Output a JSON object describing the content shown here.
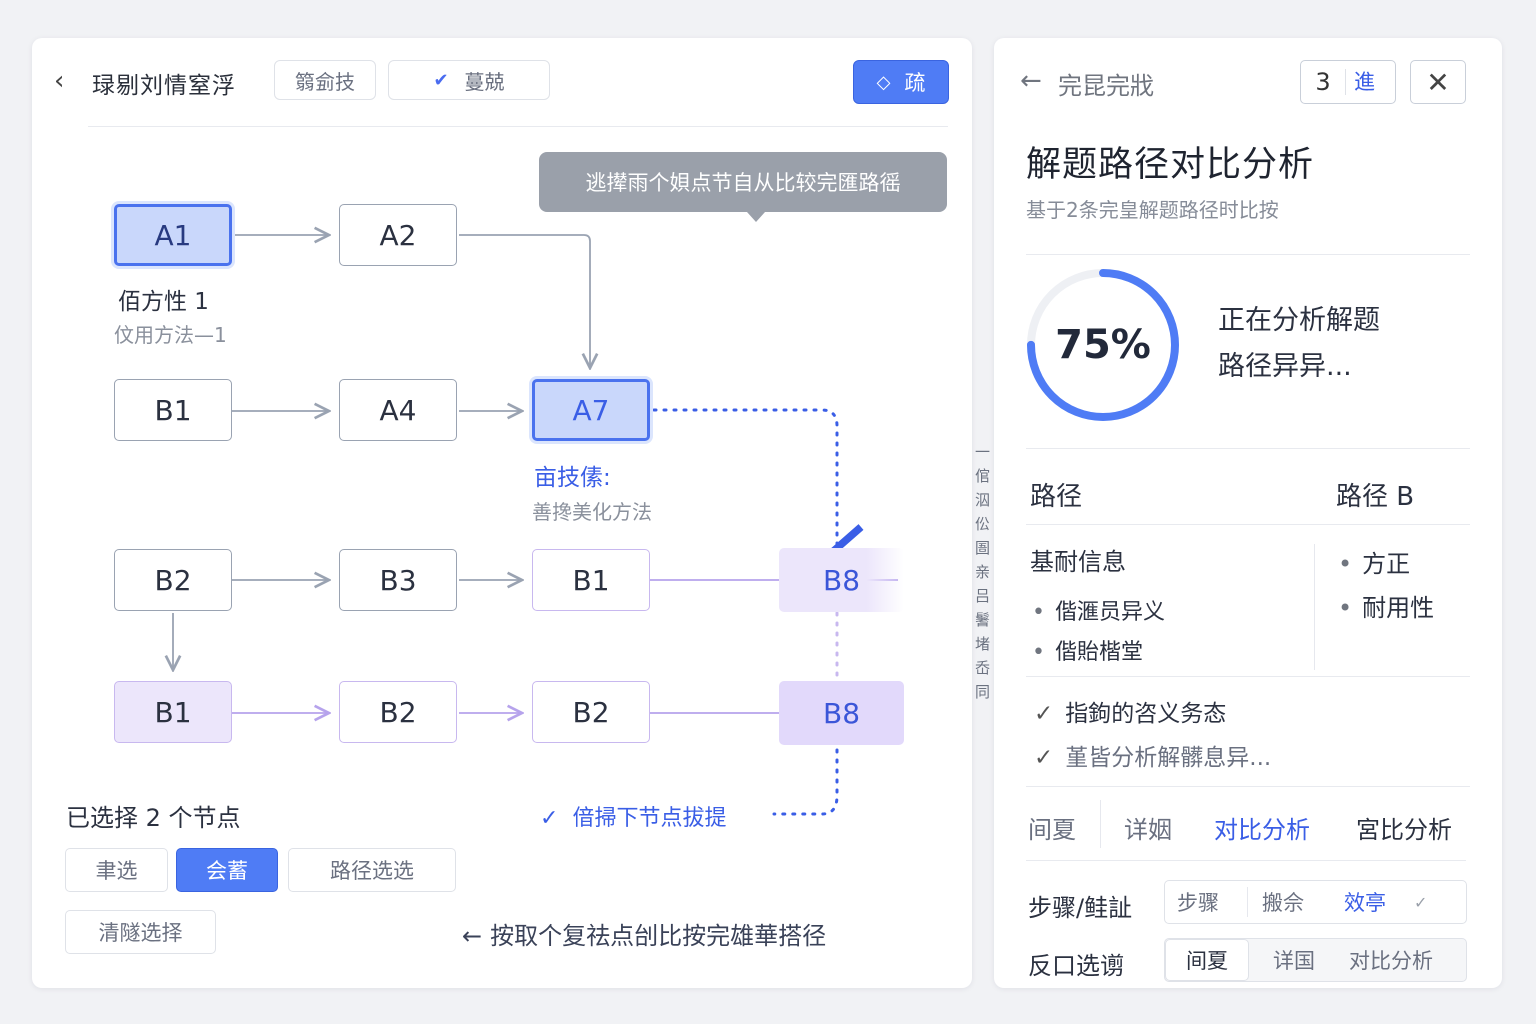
{
  "left": {
    "toolbar": {
      "title": "琭剔刘情窒浮",
      "btn1": "篛侴技",
      "btn2": "蔓兢",
      "primary": "疏"
    },
    "tooltip": "逃撵雨个㛝点节自从比较完匯路徭",
    "nodes": {
      "a1": "A1",
      "a2": "A2",
      "b1_row2": "B1",
      "a4": "A4",
      "a7": "A7",
      "b2_row3": "B2",
      "b3": "B3",
      "b1_row3": "B1",
      "b8_row3": "B8",
      "b1_row4": "B1",
      "b2_row4a": "B2",
      "b2_row4b": "B2",
      "b8_row4": "B8"
    },
    "a1_label": "佰方性 1",
    "a1_sub": "伩用方法—1",
    "a7_label": "亩技傃:",
    "a7_sub": "善搀美化方法",
    "selected_count": "已选择 2 个节点",
    "filters": {
      "f1": "聿选",
      "f2": "会蓄",
      "f3": "路径选选",
      "clear": "清隧选择"
    },
    "confirm": "偣掃下节点拔提",
    "bottom_hint": "按取个复祛点刣比按完雄華搭径",
    "vertical_text": "一倌泅伀圄亲吕鬐堵岙同"
  },
  "right": {
    "back_title": "完昆完戕",
    "badge_num": "3",
    "badge_text": "進",
    "title": "解题路径对比分析",
    "subtitle": "基于2条完皇解题路径时比按",
    "progress": {
      "value": 75,
      "label": "75%"
    },
    "status_line1": "正在分析解题",
    "status_line2": "路径异异...",
    "col_a": "路径",
    "col_b": "路径 B",
    "section": "基耐信息",
    "list_a": [
      "偕滙员异义",
      "偕貽楷堂"
    ],
    "list_b": [
      "方正",
      "耐用性"
    ],
    "checks": [
      "指鉤的咨义务态",
      "堇皆分析解髒息异..."
    ],
    "tabs": [
      "间夏",
      "详姻",
      "对比分析",
      "宮比分析"
    ],
    "row1_label": "步骤/鲑訨",
    "row1_opts": [
      "步骤",
      "搬佘",
      "效亭"
    ],
    "row2_label": "反口选谫",
    "row2_opts": [
      "间夏",
      "详国",
      "对比分析"
    ]
  },
  "colors": {
    "accent": "#4f7cf5",
    "accent_text": "#3a5ee6",
    "purple_fill": "#ece6fb",
    "node_border": "#9aa3b2"
  }
}
